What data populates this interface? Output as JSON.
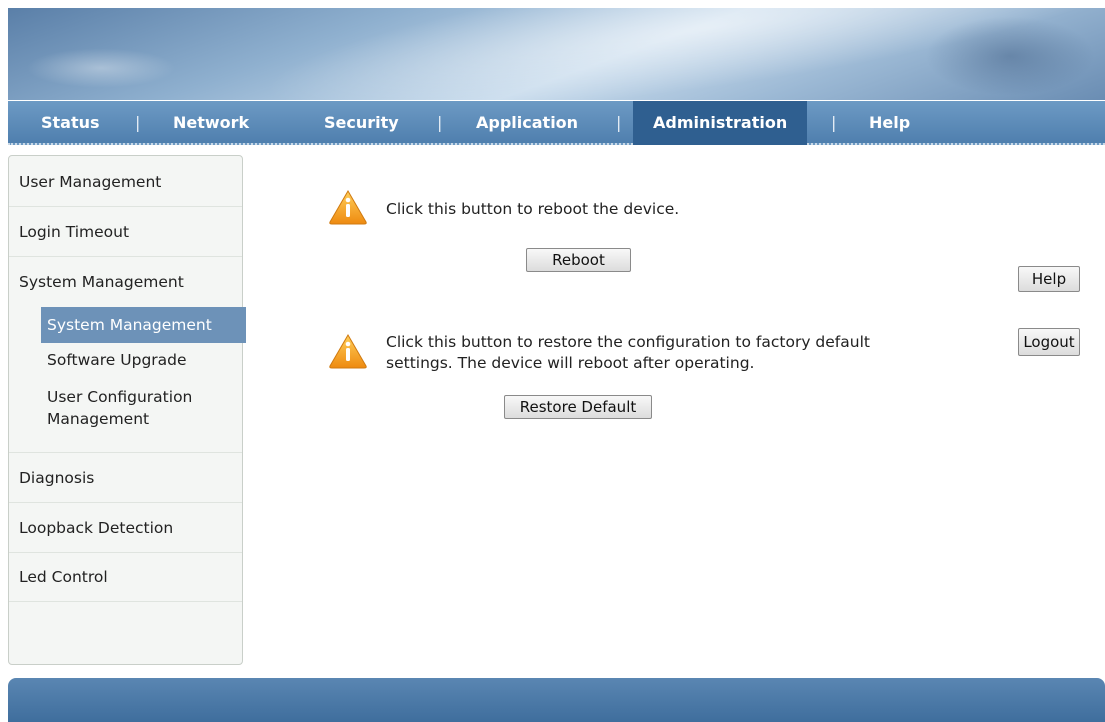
{
  "nav": {
    "items": [
      {
        "label": "Status"
      },
      {
        "label": "Network"
      },
      {
        "label": "Security"
      },
      {
        "label": "Application"
      },
      {
        "label": "Administration"
      },
      {
        "label": "Help"
      }
    ],
    "separator": "|",
    "active": "Administration"
  },
  "sidebar": {
    "items": [
      {
        "label": "User Management"
      },
      {
        "label": "Login Timeout"
      },
      {
        "label": "System Management"
      },
      {
        "label": "Diagnosis"
      },
      {
        "label": "Loopback Detection"
      },
      {
        "label": "Led Control"
      }
    ],
    "subitems": [
      {
        "label": "System Management",
        "active": true
      },
      {
        "label": "Software Upgrade"
      },
      {
        "label": "User Configuration Management"
      }
    ]
  },
  "main": {
    "reboot_message": "Click this button to reboot the device.",
    "reboot_button": "Reboot",
    "restore_message_line1": "Click this button to restore the configuration to factory default",
    "restore_message_line2": "settings. The device will reboot after operating.",
    "restore_button": "Restore Default",
    "help_button": "Help",
    "logout_button": "Logout"
  },
  "colors": {
    "nav_bg": "#5b8ab8",
    "nav_active": "#2f5f90",
    "sidebar_active": "#6d92b8",
    "warning_icon": "#f0a020"
  },
  "icons": {
    "warning": "warning-icon"
  }
}
